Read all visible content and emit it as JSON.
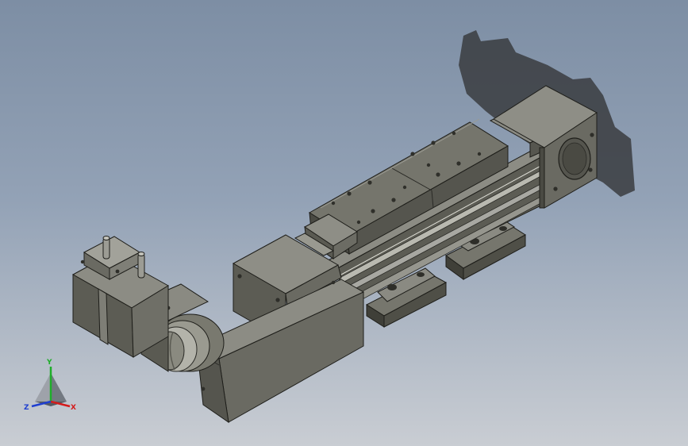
{
  "viewport": {
    "background_top": "#7d8ea4",
    "background_bottom": "#c9cdd3"
  },
  "model": {
    "colors": {
      "body": "#5f5f55",
      "body_light": "#82827a",
      "body_dark": "#45453e",
      "edge": "#1e1e1a",
      "shadow": "#3a3c40",
      "rail": "#b9b9b0",
      "steel": "#a8a8a2"
    },
    "components": [
      "servo-motor",
      "reducer-flange",
      "drive-belt-cover",
      "linear-module-body",
      "slider-carriage",
      "end-cap",
      "mounting-brackets"
    ]
  },
  "triad": {
    "x_label": "X",
    "y_label": "Y",
    "z_label": "Z",
    "x_color": "#d41b1b",
    "y_color": "#1fae2a",
    "z_color": "#1f3fd0"
  }
}
